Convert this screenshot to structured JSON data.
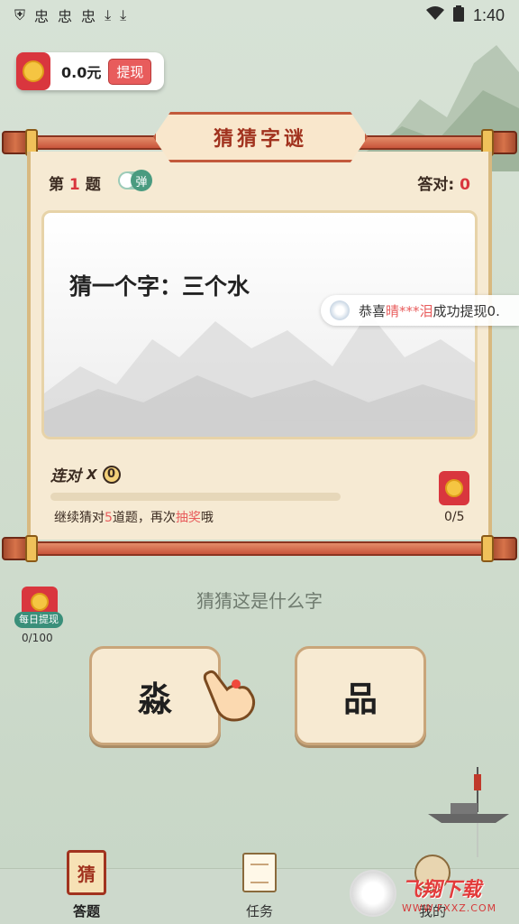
{
  "status_bar": {
    "time": "1:40",
    "left_icons": [
      "shield-icon",
      "app-icon",
      "app-icon",
      "app-icon",
      "download-icon",
      "download-icon"
    ],
    "right_icons": [
      "wifi-icon",
      "battery-icon"
    ]
  },
  "balance": {
    "amount": "0.0元",
    "withdraw_label": "提现"
  },
  "game": {
    "title": "猜猜字谜",
    "question_prefix": "第",
    "question_number": "1",
    "question_suffix": "题",
    "toggle_label": "弹",
    "correct_label": "答对:",
    "correct_count": "0",
    "riddle": "猜一个字：三个水",
    "streak_label": "连对",
    "streak_x": "X",
    "streak_count": "0",
    "progress_fraction": 0,
    "hint_prefix": "继续猜对",
    "hint_number": "5",
    "hint_mid": "道题，再次",
    "hint_highlight": "抽奖",
    "hint_suffix": "哦",
    "redpack_count": "0/5"
  },
  "ticker": {
    "prefix": "恭喜",
    "user": "晴***泪",
    "suffix": "成功提现0."
  },
  "daily": {
    "label": "每日提现",
    "count": "0/100"
  },
  "question_label": "猜猜这是什么字",
  "answers": [
    "淼",
    "品"
  ],
  "bottom_nav": {
    "items": [
      {
        "icon_text": "猜",
        "label": "答题"
      },
      {
        "label": "任务"
      },
      {
        "label": "我的"
      }
    ]
  },
  "watermark": {
    "title": "飞翔下载",
    "url": "WWW.FXXZ.COM"
  },
  "colors": {
    "accent_red": "#d9363e",
    "scroll_brown": "#c9553b",
    "paper": "#f6ead3",
    "teal": "#3a8f7a"
  }
}
